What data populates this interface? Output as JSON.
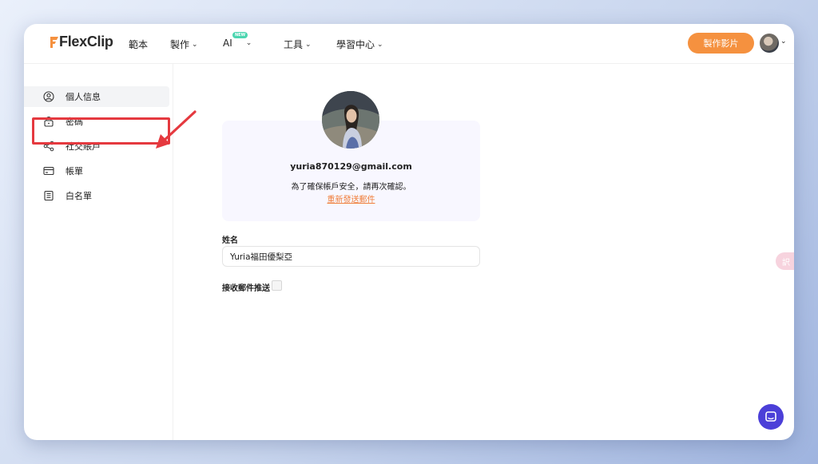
{
  "header": {
    "logo_text": "FlexClip",
    "nav": [
      {
        "label": "範本"
      },
      {
        "label": "製作",
        "chevron": "⌄"
      },
      {
        "label": "AI",
        "badge": "NEW",
        "chevron": "⌄"
      },
      {
        "label": "工具",
        "chevron": "⌄"
      },
      {
        "label": "學習中心",
        "chevron": "⌄"
      }
    ],
    "make_video_label": "製作影片"
  },
  "sidebar": {
    "items": [
      {
        "label": "個人信息",
        "icon": "user-circle-icon"
      },
      {
        "label": "密碼",
        "icon": "lock-icon"
      },
      {
        "label": "社交賬戶",
        "icon": "share-icon"
      },
      {
        "label": "帳單",
        "icon": "credit-card-icon"
      },
      {
        "label": "白名單",
        "icon": "list-icon"
      }
    ]
  },
  "profile": {
    "email": "yuria870129@gmail.com",
    "confirm_message": "為了確保帳戶安全，請再次確認。",
    "resend_link": "重新發送郵件"
  },
  "form": {
    "name_label": "姓名",
    "name_value": "Yuria福田優梨亞",
    "newsletter_label": "接收郵件推送"
  },
  "widgets": {
    "translate_glyph": "訳"
  },
  "colors": {
    "accent": "#f5913f",
    "link": "#f07f3c",
    "highlight": "#e5393f",
    "chat": "#4b3fd8"
  }
}
